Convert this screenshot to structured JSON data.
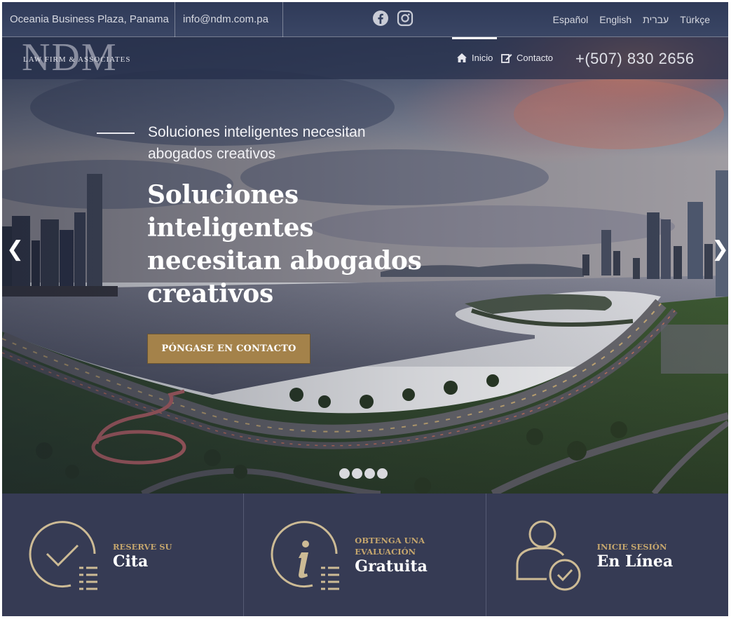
{
  "topbar": {
    "address": "Oceania Business Plaza, Panama",
    "email": "info@ndm.com.pa",
    "social_icons": [
      "facebook-icon",
      "instagram-icon"
    ],
    "languages": [
      "Español",
      "English",
      "עברית",
      "Türkçe"
    ]
  },
  "nav": {
    "logo_big": "NDM",
    "logo_small": "LAW FIRM & ASSOCIATES",
    "items": [
      {
        "label": "Inicio",
        "icon": "home-icon",
        "active": true
      },
      {
        "label": "Contacto",
        "icon": "edit-icon",
        "active": false
      }
    ],
    "phone": "+(507) 830 2656"
  },
  "hero": {
    "subtitle": "Soluciones inteligentes necesitan abogados creativos",
    "headline": "Soluciones inteligentes necesitan abogados creativos",
    "cta_label": "PÓNGASE EN CONTACTO",
    "prev_arrow": "❮",
    "next_arrow": "❯",
    "slide_count": 4
  },
  "features": [
    {
      "kicker": "RESERVE SU",
      "title": "Cita",
      "icon": "calendar-check-icon"
    },
    {
      "kicker": "OBTENGA UNA EVALUACIÓN",
      "title": "Gratuita",
      "icon": "info-icon"
    },
    {
      "kicker": "INICIE SESIÓN",
      "title": "En Línea",
      "icon": "user-check-icon"
    }
  ],
  "colors": {
    "accent_gold": "#a4824a",
    "kicker_gold": "#c5a66d",
    "feature_bg": "#363b54",
    "topbar_bg": "#2f3a58",
    "icon_stroke": "#cdbb95"
  }
}
